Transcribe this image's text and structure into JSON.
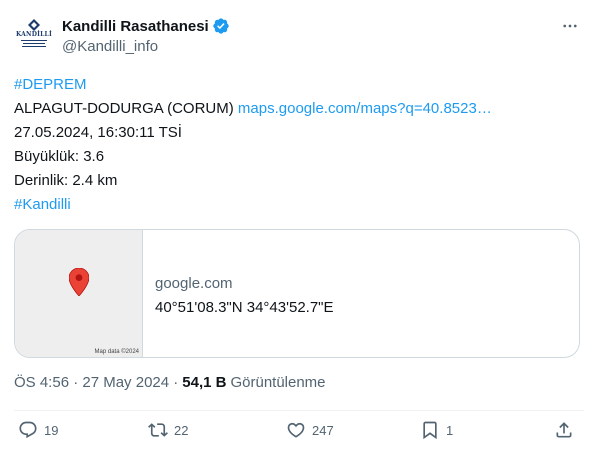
{
  "account": {
    "display_name": "Kandilli Rasathanesi",
    "handle": "@Kandilli_info",
    "avatar_text": "KANDİLLİ",
    "verified_icon": "verified-badge-icon"
  },
  "tweet": {
    "hashtag_top": "#DEPREM",
    "location_text": "ALPAGUT-DODURGA (CORUM)",
    "maps_link": "maps.google.com/maps?q=40.8523…",
    "datetime": "27.05.2024, 16:30:11 TSİ",
    "magnitude": "Büyüklük: 3.6",
    "depth": "Derinlik: 2.4 km",
    "hashtag_bottom": "#Kandilli"
  },
  "card": {
    "domain": "google.com",
    "coordinates": "40°51'08.3\"N 34°43'52.7\"E",
    "map_credit": "Map data ©2024"
  },
  "meta": {
    "timestamp": "ÖS 4:56 · 27 May 2024 ·",
    "views_count": "54,1 B",
    "views_label": "Görüntülenme"
  },
  "actions": {
    "replies": "19",
    "retweets": "22",
    "likes": "247",
    "bookmarks": "1"
  },
  "colors": {
    "link": "#1d9bf0",
    "secondary_text": "#536471",
    "primary_text": "#0f1419",
    "pin_red": "#ea4335",
    "border": "#cfd9de"
  }
}
